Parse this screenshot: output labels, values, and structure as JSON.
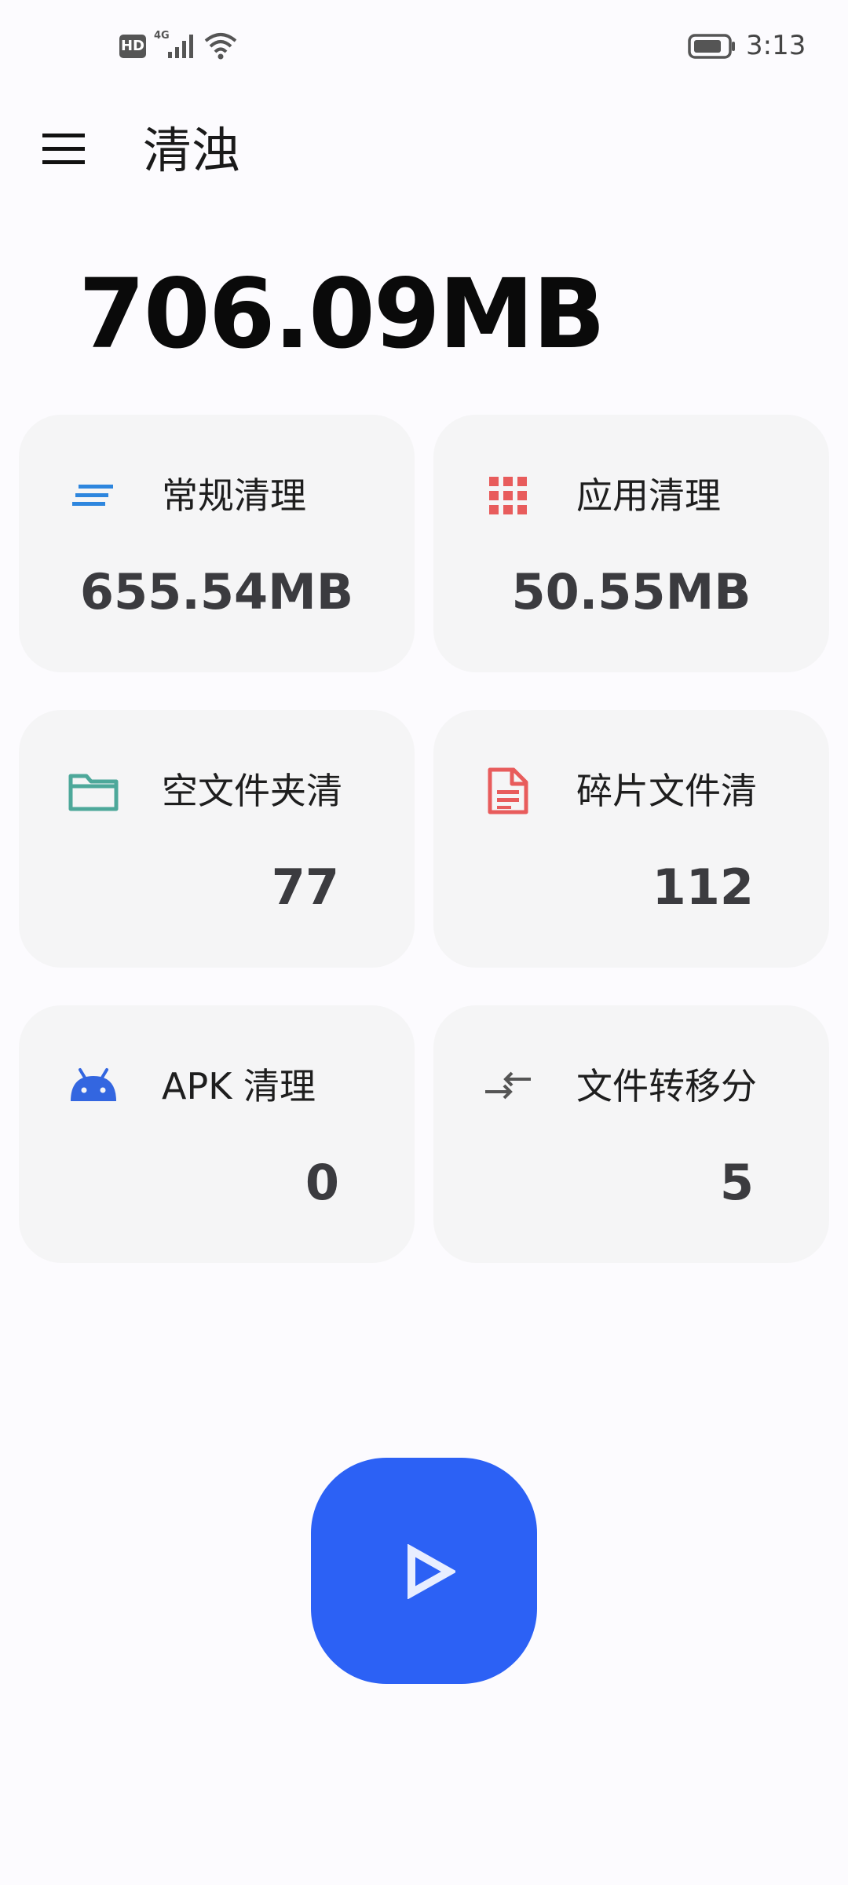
{
  "status_bar": {
    "hd_label": "HD",
    "network_label": "4G",
    "time": "3:13"
  },
  "app_bar": {
    "title": "清浊"
  },
  "summary": {
    "total_size": "706.09MB"
  },
  "cards": [
    {
      "label": "常规清理",
      "value": "655.54MB",
      "icon": "lines-icon",
      "color": "#2E86DE"
    },
    {
      "label": "应用清理",
      "value": "50.55MB",
      "icon": "grid-icon",
      "color": "#E85C5C"
    },
    {
      "label": "空文件夹清",
      "value": "77",
      "icon": "folder-icon",
      "color": "#4DA89A"
    },
    {
      "label": "碎片文件清",
      "value": "112",
      "icon": "document-icon",
      "color": "#E85C5C"
    },
    {
      "label": "APK 清理",
      "value": "0",
      "icon": "android-icon",
      "color": "#3366E0"
    },
    {
      "label": "文件转移分",
      "value": "5",
      "icon": "transfer-arrows-icon",
      "color": "#555555"
    }
  ],
  "colors": {
    "background": "#FCFBFE",
    "card_background": "#F5F5F6",
    "accent": "#2C61F5"
  },
  "play_button": {
    "icon": "play-icon"
  }
}
